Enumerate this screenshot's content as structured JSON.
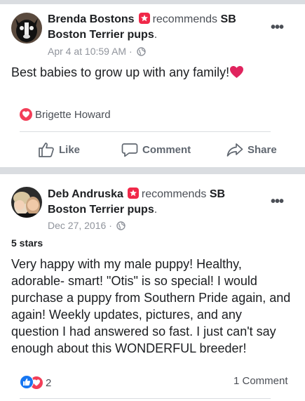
{
  "posts": [
    {
      "author": "Brenda Bostons",
      "recommends_text": "recommends",
      "page_name_part1": "SB",
      "page_name_part2": "Boston Terrier pups",
      "page_suffix": ".",
      "timestamp": "Apr 4 at 10:59 AM",
      "meta_sep": "·",
      "body": "Best babies to grow up with any family!",
      "body_emoji": "❤️",
      "reaction_name": "Brigette Howard",
      "actions": {
        "like": "Like",
        "comment": "Comment",
        "share": "Share"
      }
    },
    {
      "author": "Deb Andruska",
      "recommends_text": "recommends",
      "page_name_part1": "SB",
      "page_name_part2": "Boston Terrier pups",
      "page_suffix": ".",
      "timestamp": "Dec 27, 2016",
      "meta_sep": "·",
      "rating": "5 stars",
      "body_lines": [
        "Very happy with my male puppy!  Healthy,",
        "adorable- smart!  \"Otis\" is so special!  I would",
        "purchase a puppy from Southern Pride again, and",
        "again!  Weekly updates, pictures, and any",
        "question I had answered so fast.  I just can't say",
        "enough about this WONDERFUL breeder!"
      ],
      "reaction_count": "2",
      "comment_count": "1 Comment"
    }
  ],
  "icons": {
    "more": "more-options-icon",
    "globe": "globe-icon",
    "recommend": "recommend-badge-icon",
    "like": "thumbs-up-icon",
    "comment": "comment-icon",
    "share": "share-icon",
    "heart": "heart-reaction-icon",
    "like_reaction": "like-reaction-icon"
  },
  "colors": {
    "divider": "#dadde1",
    "recommend_badge": "#f02849",
    "heart": "#f33e58",
    "like_blue": "#1877f2",
    "meta_gray": "#90949c"
  }
}
